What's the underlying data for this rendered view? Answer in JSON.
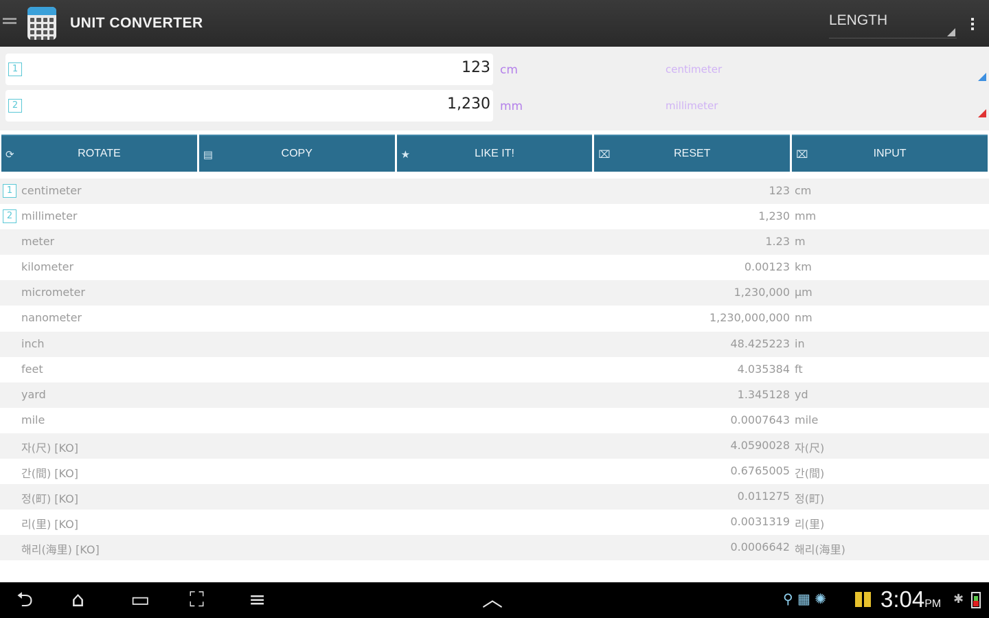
{
  "app": {
    "title": "UNIT CONVERTER",
    "category": "LENGTH"
  },
  "inputs": [
    {
      "badge": "1",
      "value": "123",
      "unit": "cm",
      "unit_name": "centimeter"
    },
    {
      "badge": "2",
      "value": "1,230",
      "unit": "mm",
      "unit_name": "millimeter"
    }
  ],
  "buttons": [
    {
      "icon": "⟳",
      "label": "ROTATE"
    },
    {
      "icon": "▤",
      "label": "COPY"
    },
    {
      "icon": "★",
      "label": "LIKE IT!"
    },
    {
      "icon": "⌧",
      "label": "RESET"
    },
    {
      "icon": "⌧",
      "label": "INPUT"
    }
  ],
  "results": [
    {
      "badge": "1",
      "name": "centimeter",
      "value": "123",
      "unit": "cm"
    },
    {
      "badge": "2",
      "name": "millimeter",
      "value": "1,230",
      "unit": "mm"
    },
    {
      "badge": "",
      "name": "meter",
      "value": "1.23",
      "unit": "m"
    },
    {
      "badge": "",
      "name": "kilometer",
      "value": "0.00123",
      "unit": "km"
    },
    {
      "badge": "",
      "name": "micrometer",
      "value": "1,230,000",
      "unit": "μm"
    },
    {
      "badge": "",
      "name": "nanometer",
      "value": "1,230,000,000",
      "unit": "nm"
    },
    {
      "badge": "",
      "name": "inch",
      "value": "48.425223",
      "unit": "in"
    },
    {
      "badge": "",
      "name": "feet",
      "value": "4.035384",
      "unit": "ft"
    },
    {
      "badge": "",
      "name": "yard",
      "value": "1.345128",
      "unit": "yd"
    },
    {
      "badge": "",
      "name": "mile",
      "value": "0.0007643",
      "unit": "mile"
    },
    {
      "badge": "",
      "name": "자(尺) [KO]",
      "value": "4.0590028",
      "unit": "자(尺)"
    },
    {
      "badge": "",
      "name": "간(間) [KO]",
      "value": "0.6765005",
      "unit": "간(間)"
    },
    {
      "badge": "",
      "name": "정(町) [KO]",
      "value": "0.011275",
      "unit": "정(町)"
    },
    {
      "badge": "",
      "name": "리(里) [KO]",
      "value": "0.0031319",
      "unit": "리(里)"
    },
    {
      "badge": "",
      "name": "해리(海里) [KO]",
      "value": "0.0006642",
      "unit": "해리(海里)"
    }
  ],
  "statusbar": {
    "time": "3:04",
    "ampm": "PM"
  }
}
